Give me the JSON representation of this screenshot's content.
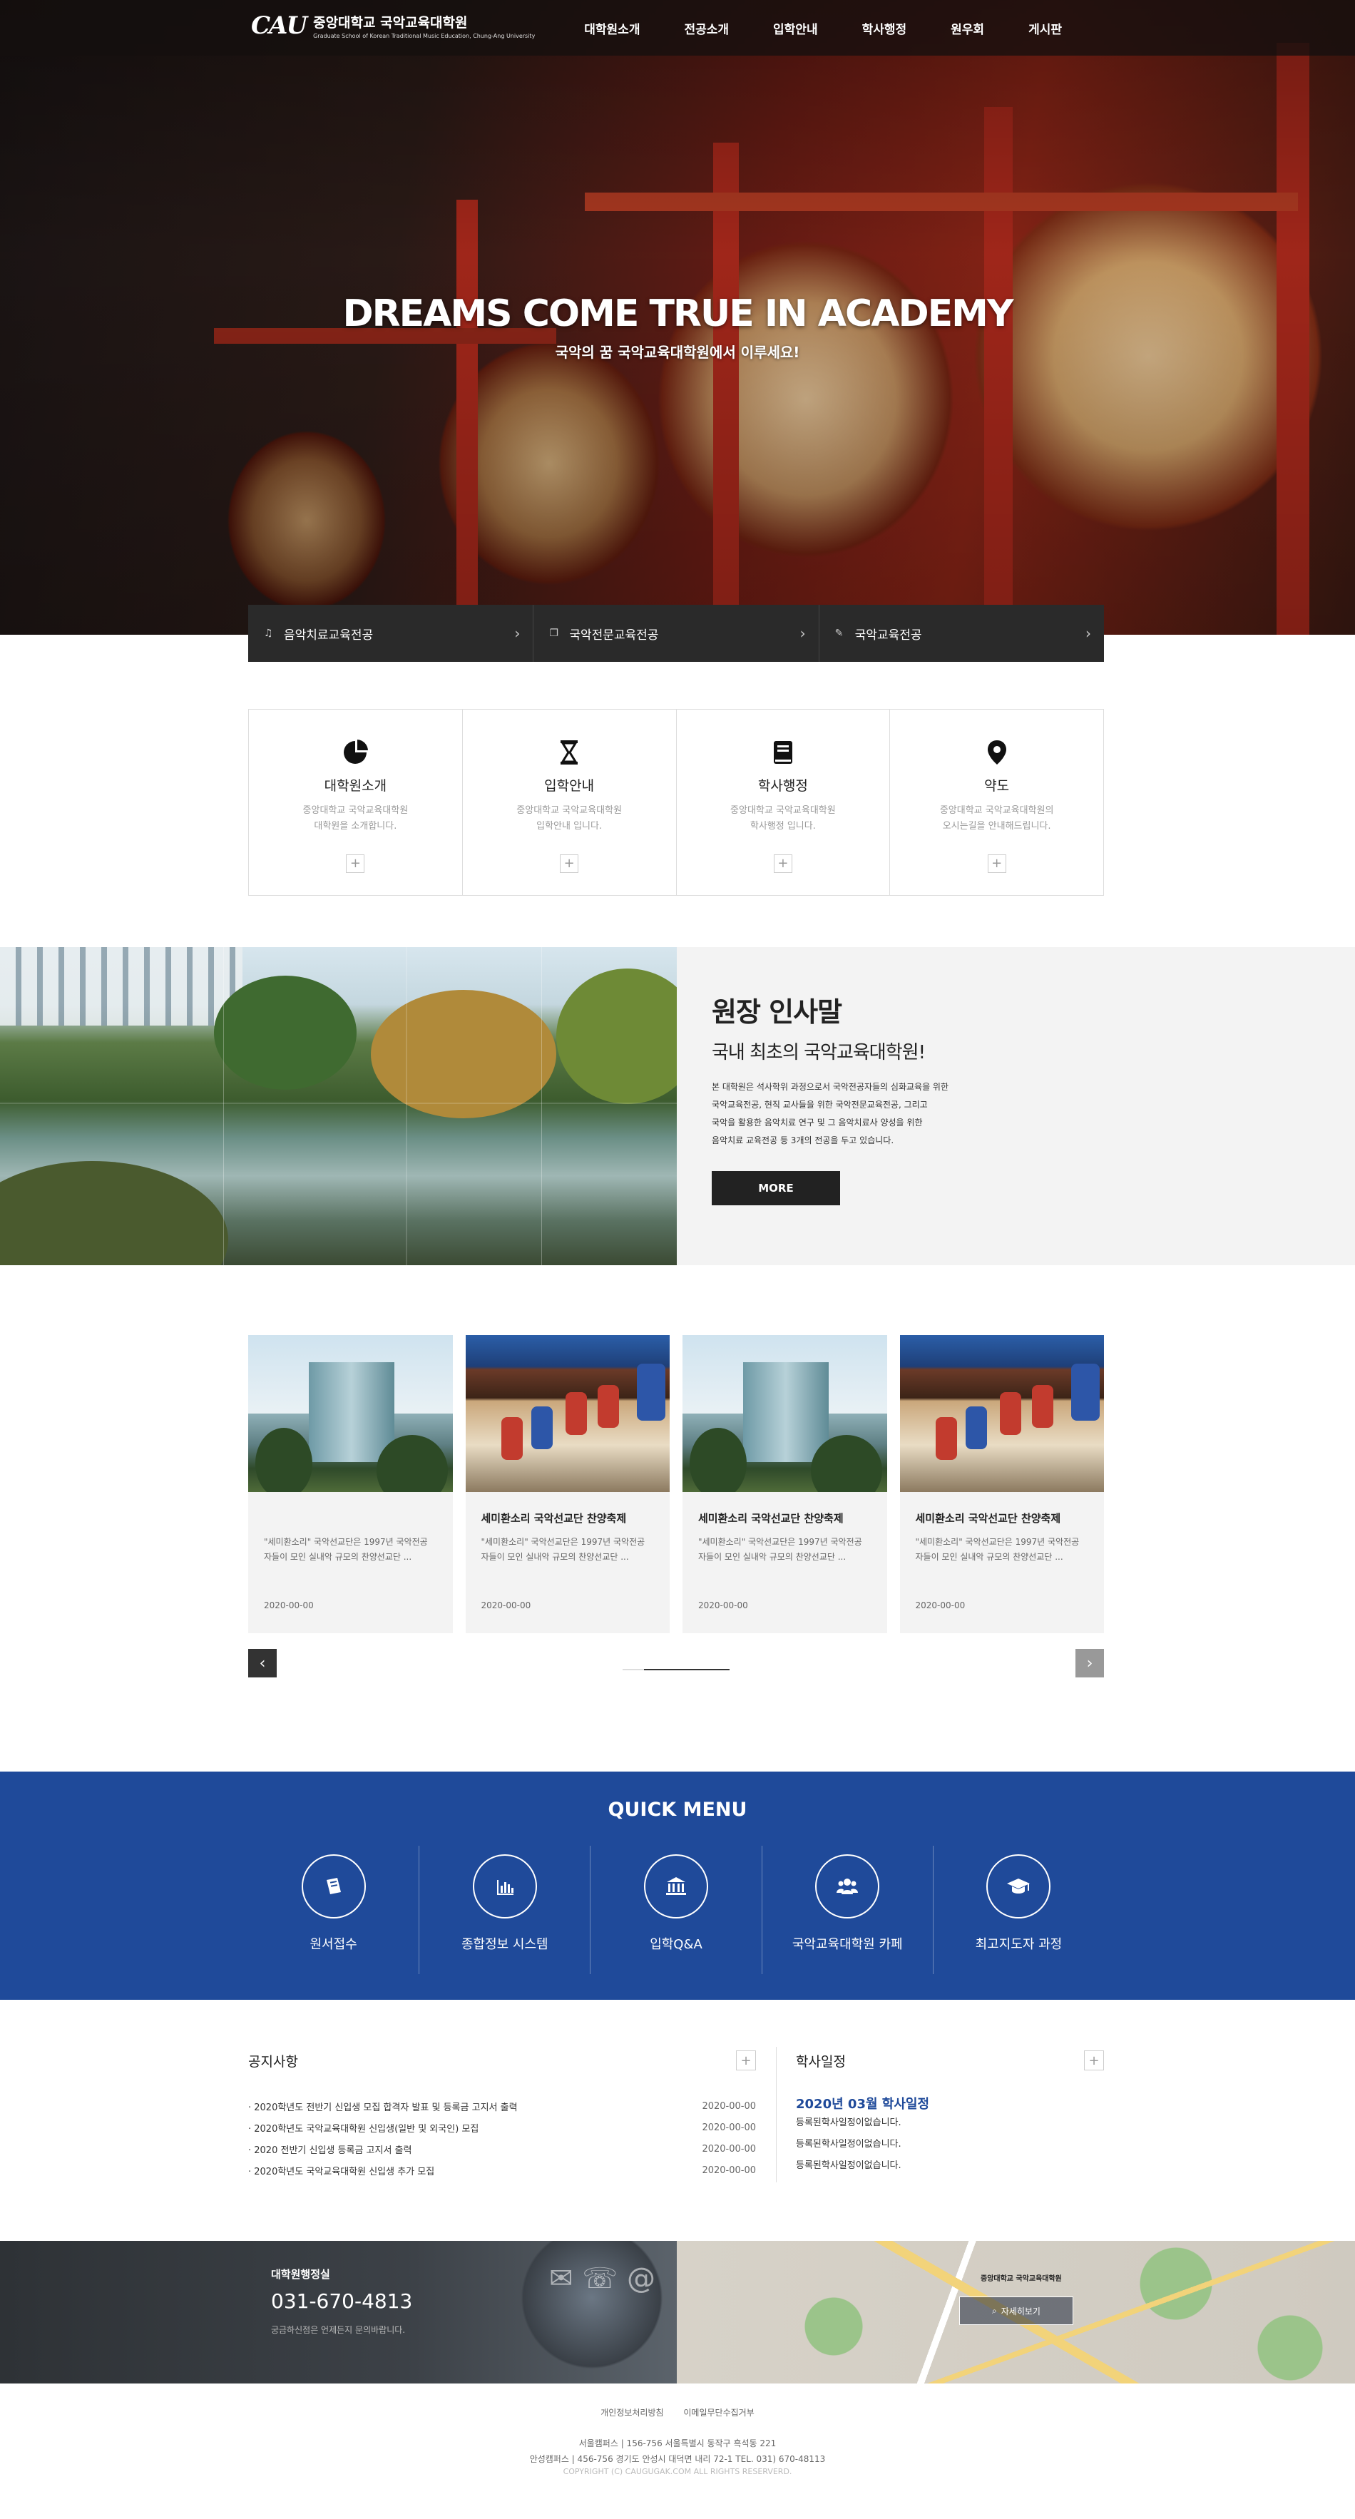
{
  "header": {
    "logo_mark": "CAU",
    "logo_name": "중앙대학교 국악교육대학원",
    "logo_sub": "Graduate School of Korean Traditional Music Education, Chung-Ang University",
    "nav": [
      "대학원소개",
      "전공소개",
      "입학안내",
      "학사행정",
      "원우회",
      "게시판"
    ]
  },
  "hero": {
    "title": "DREAMS COME TRUE IN ACADEMY",
    "subtitle": "국악의 꿈 국악교육대학원에서 이루세요!"
  },
  "majors": [
    {
      "icon": "music-note-icon",
      "label": "음악치료교육전공"
    },
    {
      "icon": "document-icon",
      "label": "국악전문교육전공"
    },
    {
      "icon": "pencil-icon",
      "label": "국악교육전공"
    }
  ],
  "info_boxes": [
    {
      "icon": "pie-chart-icon",
      "title": "대학원소개",
      "desc1": "중앙대학교 국악교육대학원",
      "desc2": "대학원을 소개합니다."
    },
    {
      "icon": "hourglass-icon",
      "title": "입학안내",
      "desc1": "중앙대학교 국악교육대학원",
      "desc2": "입학안내 입니다."
    },
    {
      "icon": "book-icon",
      "title": "학사행정",
      "desc1": "중앙대학교 국악교육대학원",
      "desc2": "학사행정 입니다."
    },
    {
      "icon": "map-pin-icon",
      "title": "약도",
      "desc1": "중앙대학교 국악교육대학원의",
      "desc2": "오시는길을 안내해드립니다."
    }
  ],
  "greeting": {
    "title": "원장 인사말",
    "subtitle": "국내 최초의 국악교육대학원!",
    "lines": [
      "본 대학원은 석사학위 과정으로서 국악전공자들의 심화교육을 위한",
      "국악교육전공, 현직 교사들을 위한 국악전문교육전공, 그리고",
      "국악을 활용한 음악치료 연구 및 그 음악치료사 양성을 위한",
      "음악치료 교육전공 등 3개의 전공을 두고 있습니다."
    ],
    "more": "MORE"
  },
  "cards": [
    {
      "title": "",
      "desc1": "\"세미환소리\" 국악선교단은 1997년 국악전공",
      "desc2": "자들이 모인 실내악 규모의 찬양선교단 ...",
      "date": "2020-00-00"
    },
    {
      "title": "세미환소리 국악선교단 찬양축제",
      "desc1": "\"세미환소리\" 국악선교단은 1997년 국악전공",
      "desc2": "자들이 모인 실내악 규모의 찬양선교단 ...",
      "date": "2020-00-00"
    },
    {
      "title": "세미환소리 국악선교단 찬양축제",
      "desc1": "\"세미환소리\" 국악선교단은 1997년 국악전공",
      "desc2": "자들이 모인 실내악 규모의 찬양선교단 ...",
      "date": "2020-00-00"
    },
    {
      "title": "세미환소리 국악선교단 찬양축제",
      "desc1": "\"세미환소리\" 국악선교단은 1997년 국악전공",
      "desc2": "자들이 모인 실내악 규모의 찬양선교단 ...",
      "date": "2020-00-00"
    }
  ],
  "quick": {
    "title": "QUICK MENU",
    "items": [
      {
        "icon": "book-icon",
        "label": "원서접수"
      },
      {
        "icon": "bar-chart-icon",
        "label": "종합정보 시스템"
      },
      {
        "icon": "institution-icon",
        "label": "입학Q&A"
      },
      {
        "icon": "users-icon",
        "label": "국악교육대학원 카페"
      },
      {
        "icon": "graduation-cap-icon",
        "label": "최고지도자 과정"
      }
    ]
  },
  "notice": {
    "title": "공지사항",
    "items": [
      {
        "text": "· 2020학년도 전반기 신입생 모집 합격자 발표 및 등록금 고지서 출력",
        "date": "2020-00-00"
      },
      {
        "text": "· 2020학년도 국악교육대학원 신입생(일반 및 외국인) 모집",
        "date": "2020-00-00"
      },
      {
        "text": "· 2020 전반기 신입생 등록금 고지서 출력",
        "date": "2020-00-00"
      },
      {
        "text": "· 2020학년도 국악교육대학원 신입생 추가 모집",
        "date": "2020-00-00"
      }
    ]
  },
  "schedule": {
    "title": "학사일정",
    "month": "2020년 03월 학사일정",
    "items": [
      "등록된학사일정이없습니다.",
      "등록된학사일정이없습니다.",
      "등록된학사일정이없습니다."
    ]
  },
  "contact": {
    "label": "대학원행정실",
    "phone": "031-670-4813",
    "note": "궁금하신점은 언제든지 문의바랍니다."
  },
  "map": {
    "pin_label": "중앙대학교 국악교육대학원",
    "button": "자세히보기"
  },
  "footer": {
    "links": [
      "개인정보처리방침",
      "이메일무단수집거부"
    ],
    "addr1": "서울캠퍼스  |  156-756 서울특별시 동작구 흑석동 221",
    "addr2": "안성캠퍼스  |  456-756 경기도 안성시 대덕면 내리 72-1 TEL. 031) 670-48113",
    "copy": "COPYRIGHT (C) CAUGUGAK.COM ALL RIGHTS RESERVERD."
  },
  "colors": {
    "accent": "#1f4a9a",
    "dark": "#222222",
    "panel": "#f3f3f3"
  }
}
